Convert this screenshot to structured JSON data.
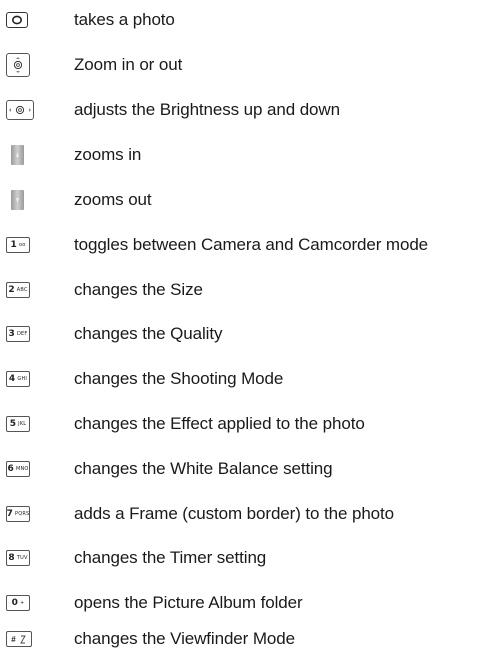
{
  "rows": [
    {
      "key_icon": "camera-shutter-key-icon",
      "label": "takes a photo"
    },
    {
      "key_icon": "nav-up-down-key-icon",
      "label": "Zoom in or out"
    },
    {
      "key_icon": "nav-left-right-key-icon",
      "label": "adjusts the Brightness up and down"
    },
    {
      "key_icon": "volume-up-key-icon",
      "label": "zooms in"
    },
    {
      "key_icon": "volume-down-key-icon",
      "label": "zooms out"
    },
    {
      "key_digit": "1",
      "key_letters": "oo",
      "label": "toggles between Camera and Camcorder mode"
    },
    {
      "key_digit": "2",
      "key_letters": "ABC",
      "label": "changes the Size"
    },
    {
      "key_digit": "3",
      "key_letters": "DEF",
      "label": "changes the Quality"
    },
    {
      "key_digit": "4",
      "key_letters": "GHI",
      "label": "changes the Shooting Mode"
    },
    {
      "key_digit": "5",
      "key_letters": "JKL",
      "label": "changes the Effect applied to the photo"
    },
    {
      "key_digit": "6",
      "key_letters": "MNO",
      "label": "changes the White Balance setting"
    },
    {
      "key_digit": "7",
      "key_letters": "PQRS",
      "label": "adds a Frame (custom border) to the photo"
    },
    {
      "key_digit": "8",
      "key_letters": "TUV",
      "label": "changes the Timer setting"
    },
    {
      "key_digit": "0",
      "key_letters": "+",
      "label": "opens the Picture Album folder"
    },
    {
      "key_digit": "#",
      "key_letters": "",
      "label": "changes the Viewfinder Mode"
    }
  ]
}
